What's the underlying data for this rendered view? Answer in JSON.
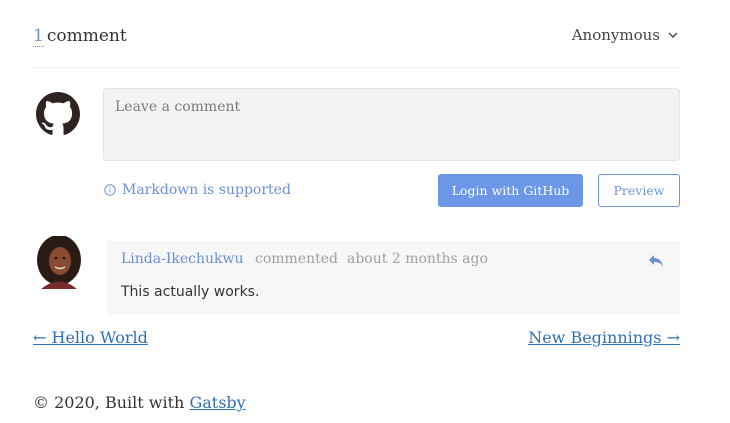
{
  "header": {
    "comment_count": "1",
    "comment_label": "comment",
    "user_menu_label": "Anonymous"
  },
  "editor": {
    "placeholder": "Leave a comment",
    "markdown_note": "Markdown is supported",
    "login_label": "Login with GitHub",
    "preview_label": "Preview"
  },
  "comments": [
    {
      "author": "Linda-Ikechukwu",
      "action": "commented",
      "time": "about 2 months ago",
      "body": "This actually works."
    }
  ],
  "pagination": {
    "prev_label": "← Hello World",
    "next_label": "New Beginnings →"
  },
  "footer": {
    "text": "© 2020, Built with",
    "link_label": "Gatsby"
  },
  "colors": {
    "accent": "#6c96e6",
    "link": "#2f6fb5",
    "muted": "#a0a0a0"
  }
}
